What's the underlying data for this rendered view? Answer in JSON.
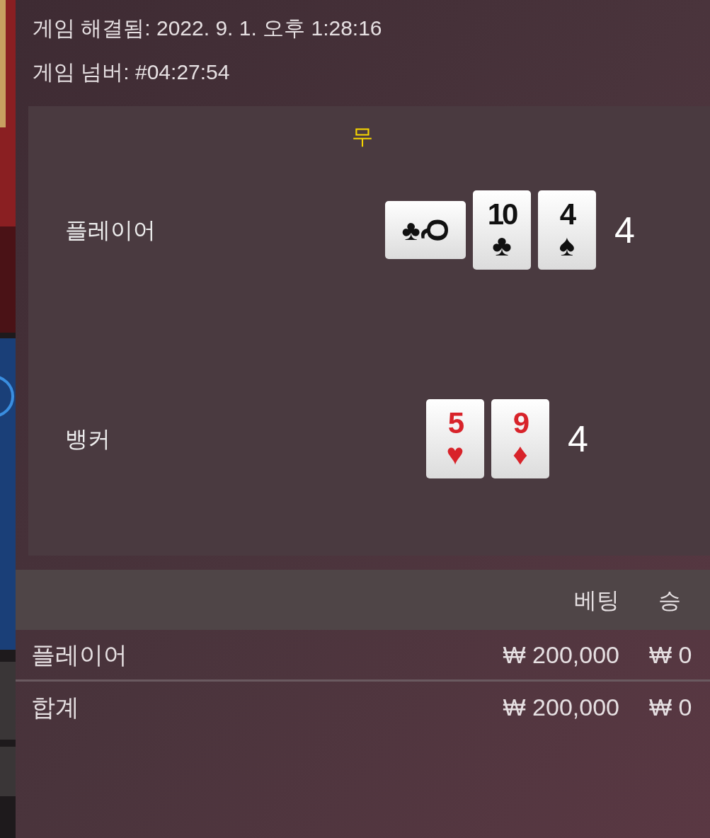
{
  "header": {
    "resolved": "게임 해결됨: 2022. 9. 1. 오후 1:28:16",
    "game_number": "게임 넘버: #04:27:54"
  },
  "result": {
    "outcome": "무",
    "hands": [
      {
        "name": "플레이어",
        "score": "4",
        "cards": [
          {
            "rank": "Q",
            "suit": "♣",
            "red": false,
            "kind": "sideways"
          },
          {
            "rank": "10",
            "suit": "♣",
            "red": false,
            "kind": "upright"
          },
          {
            "rank": "4",
            "suit": "♠",
            "red": false,
            "kind": "upright"
          }
        ]
      },
      {
        "name": "뱅커",
        "score": "4",
        "cards": [
          {
            "rank": "5",
            "suit": "♥",
            "red": true,
            "kind": "upright"
          },
          {
            "rank": "9",
            "suit": "♦",
            "red": true,
            "kind": "upright"
          }
        ]
      }
    ]
  },
  "bets": {
    "columns": [
      "베팅",
      "승"
    ],
    "rows": [
      {
        "label": "플레이어",
        "bet": "₩ 200,000",
        "win": "₩ 0"
      },
      {
        "label": "합계",
        "bet": "₩ 200,000",
        "win": "₩ 0"
      }
    ]
  }
}
